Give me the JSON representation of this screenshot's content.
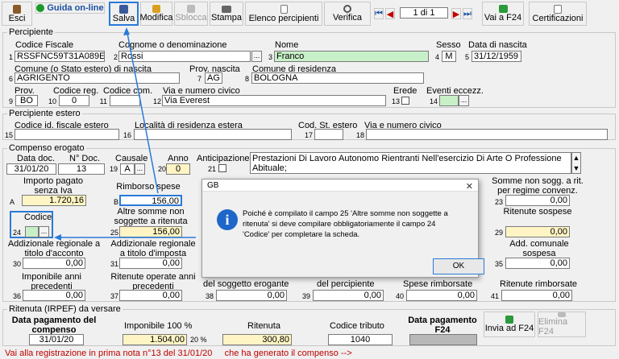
{
  "toolbar": {
    "esci": "Esci",
    "guida": "Guida on-line",
    "salva": "Salva",
    "modifica": "Modifica",
    "sblocca": "Sblocca",
    "stampa": "Stampa",
    "elenco": "Elenco percipienti",
    "verifica": "Verifica",
    "pager": "1 di 1",
    "vai_f24": "Vai a F24",
    "certificazioni": "Certificazioni"
  },
  "percipiente": {
    "title": "Percipiente",
    "codice_fiscale_label": "Codice Fiscale",
    "codice_fiscale": "RSSFNC59T31A089E",
    "cognome_label": "Cognome o denominazione",
    "cognome": "Rossi",
    "nome_label": "Nome",
    "nome": "Franco",
    "sesso_label": "Sesso",
    "sesso": "M",
    "data_nascita_label": "Data di nascita",
    "data_nascita": "31/12/1959",
    "comune_nascita_label": "Comune (o Stato estero) di nascita",
    "comune_nascita": "AGRIGENTO",
    "prov_nascita_label": "Prov. nascita",
    "prov_nascita": "AG",
    "comune_residenza_label": "Comune di residenza",
    "comune_residenza": "BOLOGNA",
    "prov_label": "Prov.",
    "prov": "BO",
    "codice_reg_label": "Codice reg.",
    "codice_reg": "0",
    "codice_com_label": "Codice com.",
    "codice_com": "",
    "via_label": "Via e numero civico",
    "via": "Via Everest",
    "erede_label": "Erede",
    "eventi_label": "Eventi eccezz.",
    "eventi": ""
  },
  "percipiente_estero": {
    "title": "Percipiente estero",
    "cf_estero_label": "Codice id. fiscale estero",
    "localita_label": "Località di residenza estera",
    "cod_st_label": "Cod. St. estero",
    "via_label": "Via e numero civico"
  },
  "compenso": {
    "title": "Compenso erogato",
    "data_doc_label": "Data doc.",
    "data_doc": "31/01/20",
    "n_doc_label": "N° Doc.",
    "n_doc": "13",
    "causale_label": "Causale",
    "causale": "A",
    "anno_label": "Anno",
    "anno": "0",
    "anticipazione_label": "Anticipazione",
    "causale_desc": "Prestazioni Di Lavoro Autonomo Rientranti Nell'esercizio Di Arte O Professione Abituale;",
    "importo_label": "Importo pagato senza Iva",
    "importo": "1.720,16",
    "rimborso_label": "Rimborso spese",
    "rimborso": "156,00",
    "altre_label": "Altre somme non soggette a ritenuta",
    "altre": "156,00",
    "codice_label": "Codice",
    "codice": "",
    "somme_regime_label": "Somme non sogg. a rit. per regime convenz.",
    "somme_regime": "0,00",
    "ritenute_sospese_label": "Ritenute sospese",
    "ritenute_sospese": "0,00",
    "add_reg_acconto_label": "Addizionale regionale a titolo d'acconto",
    "add_reg_acconto": "0,00",
    "add_reg_imposta_label": "Addizionale regionale a titolo d'imposta",
    "add_reg_imposta": "0,00",
    "add_com_sospesa_label": "Add. comunale sospesa",
    "add_com_sospesa": "0,00",
    "imponibile_prec_label": "Imponibile anni precedenti",
    "imponibile_prec": "0,00",
    "ritenute_prec_label": "Ritenute operate anni precedenti",
    "ritenute_prec": "0,00",
    "soggetto_label": "del soggetto erogante",
    "soggetto": "0,00",
    "del_percip_label": "del percipiente",
    "del_percip": "0,00",
    "spese_rimb_label": "Spese rimborsate",
    "spese_rimb": "0,00",
    "ritenute_rimb_label": "Ritenute rimborsate",
    "ritenute_rimb": "0,00"
  },
  "ritenuta": {
    "title": "Ritenuta (IRPEF) da versare",
    "data_pag_label": "Data pagamento del compenso",
    "data_pag": "31/01/20",
    "imponibile_label": "Imponibile 100 %",
    "imponibile": "1.504,00",
    "perc": "20 %",
    "ritenuta_label": "Ritenuta",
    "ritenuta": "300,80",
    "codice_tributo_label": "Codice tributo",
    "codice_tributo": "1040",
    "data_f24_label": "Data pagamento F24",
    "invia_f24": "Invia ad F24",
    "elimina_f24": "Elimina F24"
  },
  "status_text": "Vai alla registrazione in prima nota n°13 del 31/01/20     che ha generato il compenso -->",
  "dialog": {
    "title": "GB",
    "message": "Poiché è compilato il campo 25 'Altre somme non soggette a ritenuta' si deve compilare obbligatoriamente il campo 24 'Codice' per completare la scheda.",
    "ok": "OK"
  },
  "numbers": {
    "n1": "1",
    "n2": "2",
    "n3": "3",
    "n4": "4",
    "n5": "5",
    "n6": "6",
    "n7": "7",
    "n8": "8",
    "n9": "9",
    "n10": "10",
    "n11": "11",
    "n12": "12",
    "n13": "13",
    "n14": "14",
    "n15": "15",
    "n16": "16",
    "n17": "17",
    "n18": "18",
    "n19": "19",
    "n20": "20",
    "n21": "21",
    "n23": "23",
    "n24": "24",
    "n25": "25",
    "n29": "29",
    "n30": "30",
    "n31": "31",
    "n35": "35",
    "n36": "36",
    "n37": "37",
    "n38": "38",
    "n39": "39",
    "n40": "40",
    "n41": "41",
    "nA": "A",
    "nB": "B"
  },
  "colors": {
    "accent": "#2a7ad8",
    "field_green": "#c8f0c8",
    "field_yellow": "#fff5c4",
    "status_red": "#c00000"
  }
}
